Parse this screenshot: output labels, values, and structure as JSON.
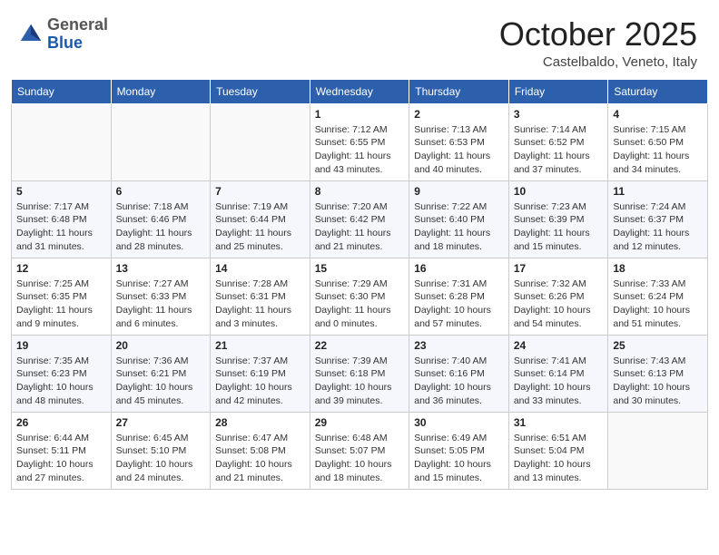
{
  "header": {
    "logo": {
      "general": "General",
      "blue": "Blue"
    },
    "title": "October 2025",
    "location": "Castelbaldo, Veneto, Italy"
  },
  "calendar": {
    "weekdays": [
      "Sunday",
      "Monday",
      "Tuesday",
      "Wednesday",
      "Thursday",
      "Friday",
      "Saturday"
    ],
    "weeks": [
      [
        {
          "day": "",
          "info": ""
        },
        {
          "day": "",
          "info": ""
        },
        {
          "day": "",
          "info": ""
        },
        {
          "day": "1",
          "info": "Sunrise: 7:12 AM\nSunset: 6:55 PM\nDaylight: 11 hours and 43 minutes."
        },
        {
          "day": "2",
          "info": "Sunrise: 7:13 AM\nSunset: 6:53 PM\nDaylight: 11 hours and 40 minutes."
        },
        {
          "day": "3",
          "info": "Sunrise: 7:14 AM\nSunset: 6:52 PM\nDaylight: 11 hours and 37 minutes."
        },
        {
          "day": "4",
          "info": "Sunrise: 7:15 AM\nSunset: 6:50 PM\nDaylight: 11 hours and 34 minutes."
        }
      ],
      [
        {
          "day": "5",
          "info": "Sunrise: 7:17 AM\nSunset: 6:48 PM\nDaylight: 11 hours and 31 minutes."
        },
        {
          "day": "6",
          "info": "Sunrise: 7:18 AM\nSunset: 6:46 PM\nDaylight: 11 hours and 28 minutes."
        },
        {
          "day": "7",
          "info": "Sunrise: 7:19 AM\nSunset: 6:44 PM\nDaylight: 11 hours and 25 minutes."
        },
        {
          "day": "8",
          "info": "Sunrise: 7:20 AM\nSunset: 6:42 PM\nDaylight: 11 hours and 21 minutes."
        },
        {
          "day": "9",
          "info": "Sunrise: 7:22 AM\nSunset: 6:40 PM\nDaylight: 11 hours and 18 minutes."
        },
        {
          "day": "10",
          "info": "Sunrise: 7:23 AM\nSunset: 6:39 PM\nDaylight: 11 hours and 15 minutes."
        },
        {
          "day": "11",
          "info": "Sunrise: 7:24 AM\nSunset: 6:37 PM\nDaylight: 11 hours and 12 minutes."
        }
      ],
      [
        {
          "day": "12",
          "info": "Sunrise: 7:25 AM\nSunset: 6:35 PM\nDaylight: 11 hours and 9 minutes."
        },
        {
          "day": "13",
          "info": "Sunrise: 7:27 AM\nSunset: 6:33 PM\nDaylight: 11 hours and 6 minutes."
        },
        {
          "day": "14",
          "info": "Sunrise: 7:28 AM\nSunset: 6:31 PM\nDaylight: 11 hours and 3 minutes."
        },
        {
          "day": "15",
          "info": "Sunrise: 7:29 AM\nSunset: 6:30 PM\nDaylight: 11 hours and 0 minutes."
        },
        {
          "day": "16",
          "info": "Sunrise: 7:31 AM\nSunset: 6:28 PM\nDaylight: 10 hours and 57 minutes."
        },
        {
          "day": "17",
          "info": "Sunrise: 7:32 AM\nSunset: 6:26 PM\nDaylight: 10 hours and 54 minutes."
        },
        {
          "day": "18",
          "info": "Sunrise: 7:33 AM\nSunset: 6:24 PM\nDaylight: 10 hours and 51 minutes."
        }
      ],
      [
        {
          "day": "19",
          "info": "Sunrise: 7:35 AM\nSunset: 6:23 PM\nDaylight: 10 hours and 48 minutes."
        },
        {
          "day": "20",
          "info": "Sunrise: 7:36 AM\nSunset: 6:21 PM\nDaylight: 10 hours and 45 minutes."
        },
        {
          "day": "21",
          "info": "Sunrise: 7:37 AM\nSunset: 6:19 PM\nDaylight: 10 hours and 42 minutes."
        },
        {
          "day": "22",
          "info": "Sunrise: 7:39 AM\nSunset: 6:18 PM\nDaylight: 10 hours and 39 minutes."
        },
        {
          "day": "23",
          "info": "Sunrise: 7:40 AM\nSunset: 6:16 PM\nDaylight: 10 hours and 36 minutes."
        },
        {
          "day": "24",
          "info": "Sunrise: 7:41 AM\nSunset: 6:14 PM\nDaylight: 10 hours and 33 minutes."
        },
        {
          "day": "25",
          "info": "Sunrise: 7:43 AM\nSunset: 6:13 PM\nDaylight: 10 hours and 30 minutes."
        }
      ],
      [
        {
          "day": "26",
          "info": "Sunrise: 6:44 AM\nSunset: 5:11 PM\nDaylight: 10 hours and 27 minutes."
        },
        {
          "day": "27",
          "info": "Sunrise: 6:45 AM\nSunset: 5:10 PM\nDaylight: 10 hours and 24 minutes."
        },
        {
          "day": "28",
          "info": "Sunrise: 6:47 AM\nSunset: 5:08 PM\nDaylight: 10 hours and 21 minutes."
        },
        {
          "day": "29",
          "info": "Sunrise: 6:48 AM\nSunset: 5:07 PM\nDaylight: 10 hours and 18 minutes."
        },
        {
          "day": "30",
          "info": "Sunrise: 6:49 AM\nSunset: 5:05 PM\nDaylight: 10 hours and 15 minutes."
        },
        {
          "day": "31",
          "info": "Sunrise: 6:51 AM\nSunset: 5:04 PM\nDaylight: 10 hours and 13 minutes."
        },
        {
          "day": "",
          "info": ""
        }
      ]
    ]
  }
}
